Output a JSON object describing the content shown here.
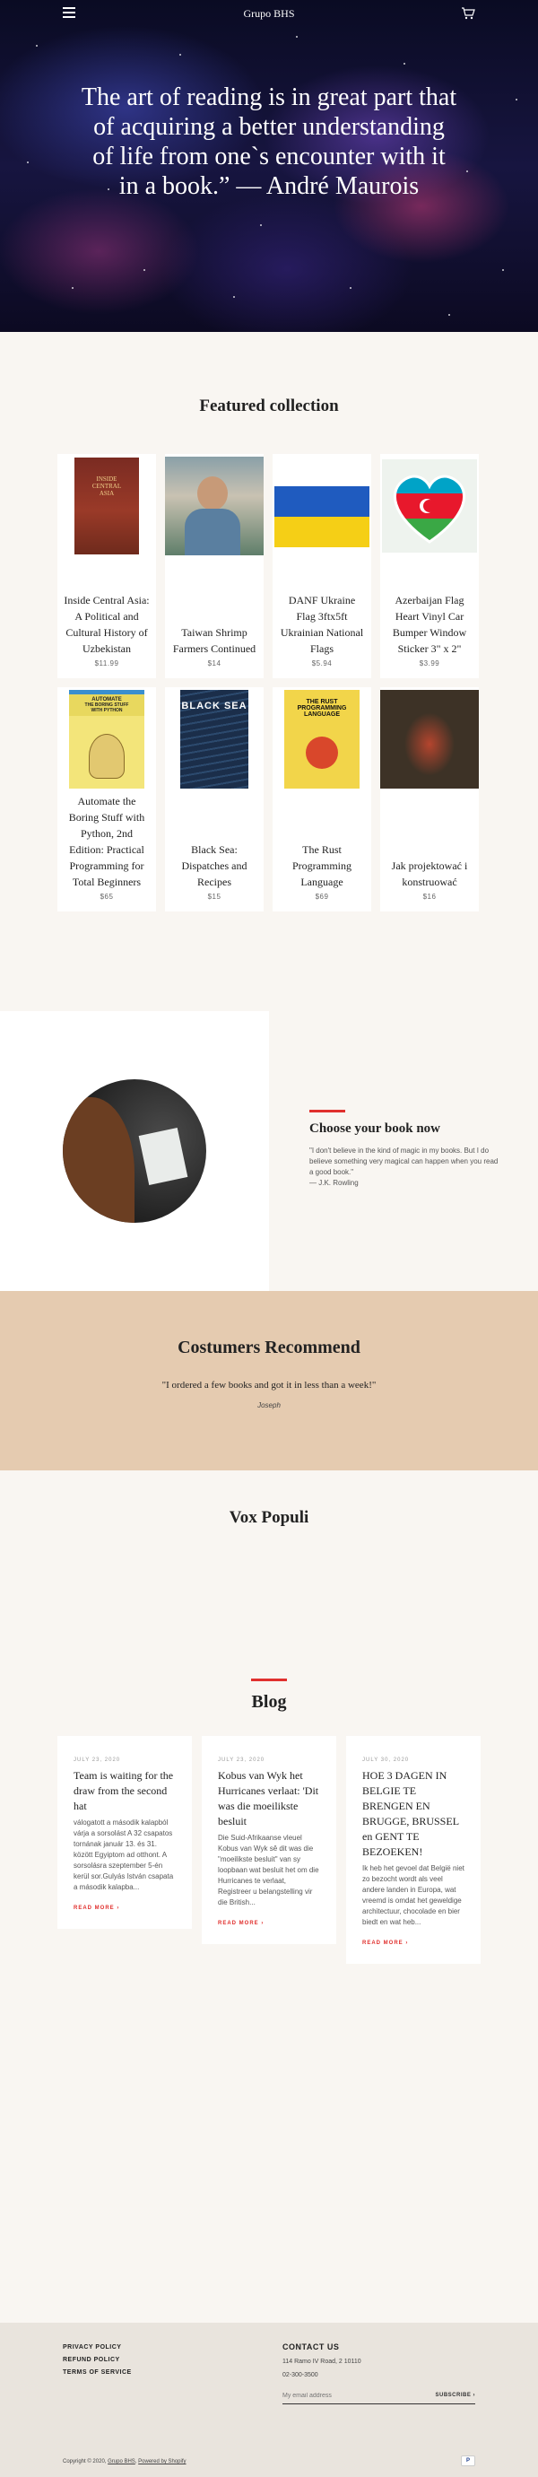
{
  "header": {
    "brand": "Grupo BHS"
  },
  "hero": {
    "quote": "The art of reading is in great part that of acquiring a better understanding of life from one`s encounter with it in a book.” — André Maurois"
  },
  "featured": {
    "title": "Featured collection",
    "products": [
      {
        "title": "Inside Central Asia: A Political and Cultural History of Uzbekistan",
        "price": "$11.99"
      },
      {
        "title": "Taiwan Shrimp Farmers Continued",
        "price": "$14"
      },
      {
        "title": "DANF Ukraine Flag 3ftx5ft Ukrainian National Flags",
        "price": "$5.94"
      },
      {
        "title": "Azerbaijan Flag Heart Vinyl Car Bumper Window Sticker 3\" x 2\"",
        "price": "$3.99"
      },
      {
        "title": "Automate the Boring Stuff with Python, 2nd Edition: Practical Programming for Total Beginners",
        "price": "$65"
      },
      {
        "title": "Black Sea: Dispatches and Recipes",
        "price": "$15"
      },
      {
        "title": "The Rust Programming Language",
        "price": "$69"
      },
      {
        "title": "Jak projektować i konstruować",
        "price": "$16"
      }
    ],
    "covers": {
      "automate": [
        "AUTOMATE",
        "THE BORING STUFF",
        "WITH PYTHON"
      ],
      "blacksea": "BLACK SEA",
      "rust": [
        "THE RUST",
        "PROGRAMMING",
        "LANGUAGE"
      ],
      "central_asia": [
        "INSIDE",
        "CENTRAL",
        "ASIA"
      ]
    }
  },
  "choose": {
    "title": "Choose your book now",
    "text": "\"I don't believe in the kind of magic in my books. But I do believe something very magical can happen when you read a good book.\"",
    "author": "— J.K. Rowling"
  },
  "recommend": {
    "title": "Costumers Recommend",
    "quote": "\"I ordered a few books and got it in less than a week!\"",
    "author": "Joseph"
  },
  "vox": {
    "title": "Vox Populi"
  },
  "blog": {
    "title": "Blog",
    "posts": [
      {
        "date": "JULY 23, 2020",
        "title": "Team is waiting for the draw from the second hat",
        "excerpt": "válogatott a második kalapból várja a sorsolást A 32 csapatos tornának január 13. és 31. között Egyiptom ad otthont. A sorsolásra szeptember 5-én kerül sor.Gulyás István csapata a második kalapba...",
        "more": "READ MORE"
      },
      {
        "date": "JULY 23, 2020",
        "title": "Kobus van Wyk het Hurricanes verlaat: 'Dit was die moeilikste besluit",
        "excerpt": "Die Suid-Afrikaanse vleuel Kobus van Wyk sê dit was die \"moeilikste besluit\" van sy loopbaan wat besluit het om die Hurricanes te verlaat, Registreer u belangstelling vir die British...",
        "more": "READ MORE"
      },
      {
        "date": "JULY 30, 2020",
        "title": "HOE 3 DAGEN IN BELGIE TE BRENGEN EN BRUGGE, BRUSSEL en GENT TE BEZOEKEN!",
        "excerpt": "Ik heb het gevoel dat België niet zo bezocht wordt als veel andere landen in Europa, wat vreemd is omdat het geweldige architectuur, chocolade en bier biedt en wat heb...",
        "more": "READ MORE"
      }
    ]
  },
  "footer": {
    "links": [
      "PRIVACY POLICY",
      "REFUND POLICY",
      "TERMS OF SERVICE"
    ],
    "contact_title": "CONTACT US",
    "address": "114 Ramo IV Road, 2 10110",
    "phone": "02-300-3500",
    "email_placeholder": "My email address",
    "subscribe": "SUBSCRIBE",
    "copyright_prefix": "Copyright © 2020,",
    "shop_link": "Grupo BHS",
    "powered": "Powered by Shopify",
    "payment": "P"
  }
}
